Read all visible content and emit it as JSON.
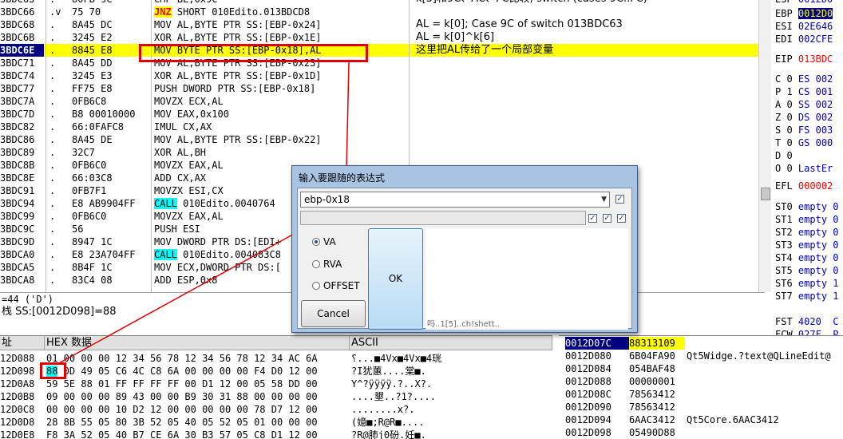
{
  "disasm": {
    "rows": [
      {
        "addr": "3BDC63",
        "mark": ".",
        "hex": "80FB 9C",
        "asm": "CMP BL,0x9C",
        "comment": "k[3]和9C、AC、FC比较; switch (cases 9C..FC)"
      },
      {
        "addr": "3BDC66",
        "mark": ".v",
        "hex": "75 70",
        "asm_jmp": "JNZ",
        "asm": " SHORT 010Edito.013BDCD8",
        "comment": ""
      },
      {
        "addr": "3BDC68",
        "mark": ".",
        "hex": "8A45 DC",
        "asm": "MOV AL,BYTE PTR SS:[EBP-0x24]",
        "comment": "AL = k[0]; Case 9C of switch 013BDC63"
      },
      {
        "addr": "3BDC6B",
        "mark": ".",
        "hex": "3245 E2",
        "asm": "XOR AL,BYTE PTR SS:[EBP-0x1E]",
        "comment": "AL = k[0]^k[6]"
      },
      {
        "addr": "3BDC6E",
        "mark": ".",
        "hex": "8845 E8",
        "asm": "MOV BYTE PTR SS:[EBP-0x18],AL",
        "comment": "这里把AL传给了一个局部变量"
      },
      {
        "addr": "3BDC71",
        "mark": ".",
        "hex": "8A45 DD",
        "asm": "MOV AL,BYTE PTR SS:[EBP-0x23]",
        "comment": ""
      },
      {
        "addr": "3BDC74",
        "mark": ".",
        "hex": "3245 E3",
        "asm": "XOR AL,BYTE PTR SS:[EBP-0x1D]",
        "comment": ""
      },
      {
        "addr": "3BDC77",
        "mark": ".",
        "hex": "FF75 E8",
        "asm": "PUSH DWORD PTR SS:[EBP-0x18]",
        "comment": ""
      },
      {
        "addr": "3BDC7A",
        "mark": ".",
        "hex": "0FB6C8",
        "asm": "MOVZX ECX,AL",
        "comment": ""
      },
      {
        "addr": "3BDC7D",
        "mark": ".",
        "hex": "B8 00010000",
        "asm": "MOV EAX,0x100",
        "comment": ""
      },
      {
        "addr": "3BDC82",
        "mark": ".",
        "hex": "66:0FAFC8",
        "asm": "IMUL CX,AX",
        "comment": ""
      },
      {
        "addr": "3BDC86",
        "mark": ".",
        "hex": "8A45 DE",
        "asm": "MOV AL,BYTE PTR SS:[EBP-0x22]",
        "comment": ""
      },
      {
        "addr": "3BDC89",
        "mark": ".",
        "hex": "32C7",
        "asm": "XOR AL,BH",
        "comment": ""
      },
      {
        "addr": "3BDC8B",
        "mark": ".",
        "hex": "0FB6C0",
        "asm": "MOVZX EAX,AL",
        "comment": ""
      },
      {
        "addr": "3BDC8E",
        "mark": ".",
        "hex": "66:03C8",
        "asm": "ADD CX,AX",
        "comment": ""
      },
      {
        "addr": "3BDC91",
        "mark": ".",
        "hex": "0FB7F1",
        "asm": "MOVZX ESI,CX",
        "comment": ""
      },
      {
        "addr": "3BDC94",
        "mark": ".",
        "hex": "E8 AB9904FF",
        "asm_call": "CALL",
        "asm": " 010Edito.0040764",
        "comment": ""
      },
      {
        "addr": "3BDC99",
        "mark": ".",
        "hex": "0FB6C0",
        "asm": "MOVZX EAX,AL",
        "comment": ""
      },
      {
        "addr": "3BDC9C",
        "mark": ".",
        "hex": "56",
        "asm": "PUSH ESI",
        "comment": ""
      },
      {
        "addr": "3BDC9D",
        "mark": ".",
        "hex": "8947 1C",
        "asm": "MOV DWORD PTR DS:[EDI+",
        "comment": ""
      },
      {
        "addr": "3BDCA0",
        "mark": ".",
        "hex": "E8 23A704FF",
        "asm_call": "CALL",
        "asm": " 010Edito.004083C8",
        "comment": ""
      },
      {
        "addr": "3BDCA5",
        "mark": ".",
        "hex": "8B4F 1C",
        "asm": "MOV ECX,DWORD PTR DS:[",
        "comment": ""
      },
      {
        "addr": "3BDCA8",
        "mark": ".",
        "hex": "83C4 08",
        "asm": "ADD ESP,0x8",
        "comment": ""
      }
    ]
  },
  "registers": [
    {
      "name": "ESP",
      "val": "0012D0"
    },
    {
      "name": "EBP",
      "val": "0012D0",
      "sel": true
    },
    {
      "name": "ESI",
      "val": "02E646"
    },
    {
      "name": "EDI",
      "val": "002CFE"
    },
    {
      "name": "",
      "val": ""
    },
    {
      "name": "EIP",
      "val": "013BDC",
      "red": true
    },
    {
      "name": "",
      "val": ""
    },
    {
      "name": "C 0",
      "val": "ES 002"
    },
    {
      "name": "P 1",
      "val": "CS 001"
    },
    {
      "name": "A 0",
      "val": "SS 002"
    },
    {
      "name": "Z 0",
      "val": "DS 002",
      "redname": true
    },
    {
      "name": "S 0",
      "val": "FS 003"
    },
    {
      "name": "T 0",
      "val": "GS 000"
    },
    {
      "name": "D 0",
      "val": ""
    },
    {
      "name": "O 0",
      "val": "LastEr"
    },
    {
      "name": "",
      "val": ""
    },
    {
      "name": "EFL",
      "val": "000002",
      "red": true
    },
    {
      "name": "",
      "val": ""
    },
    {
      "name": "ST0",
      "val": "empty 0"
    },
    {
      "name": "ST1",
      "val": "empty 0"
    },
    {
      "name": "ST2",
      "val": "empty 0"
    },
    {
      "name": "ST3",
      "val": "empty 0"
    },
    {
      "name": "ST4",
      "val": "empty 0"
    },
    {
      "name": "ST5",
      "val": "empty 0"
    },
    {
      "name": "ST6",
      "val": "empty 1"
    },
    {
      "name": "ST7",
      "val": "empty 1"
    },
    {
      "name": "",
      "val": ""
    },
    {
      "name": "FST",
      "val": "4020  C"
    },
    {
      "name": "FCW",
      "val": "027F  P"
    }
  ],
  "info": {
    "line1": "=44 ('D')",
    "line2": "栈 SS:[0012D098]=88"
  },
  "dump": {
    "col_addr": "址",
    "col_hex": "HEX 数据",
    "col_ascii": "ASCII",
    "rows": [
      {
        "addr": "12D088",
        "hex_pre": "",
        "hex_sel": "",
        "hex": "01 00 00 00 12 34 56 78 12 34 56 78 12 34 AC 6A",
        "ascii": "⸮...■4Vx■4Vx■4珖"
      },
      {
        "addr": "12D098",
        "hex_pre": "",
        "hex_sel": "88",
        "hex": " 0D 49 05 C6 4C C8 6A 00 00 00 00 F4 D0 12 00",
        "ascii": "?I犹蕙....棠■."
      },
      {
        "addr": "12D0A8",
        "hex_pre": "",
        "hex_sel": "",
        "hex": "59 5E 88 01 FF FF FF FF 00 D1 12 00 05 58 DD 00",
        "ascii": "Y^?ÿÿÿÿ.?..X?."
      },
      {
        "addr": "12D0B8",
        "hex_pre": "",
        "hex_sel": "",
        "hex": "09 00 00 00 89 43 00 00 B9 30 31 88 00 00 00 00",
        "ascii": "....墾..?1?...."
      },
      {
        "addr": "12D0C8",
        "hex_pre": "",
        "hex_sel": "",
        "hex": "00 00 00 00 10 D2 12 00 00 00 00 00 78 D7 12 00",
        "ascii": "........x?."
      },
      {
        "addr": "12D0D8",
        "hex_pre": "",
        "hex_sel": "",
        "hex": "28 8B 55 05 80 3B 52 05 40 05 52 05 01 00 00 00",
        "ascii": "(嬑■;R@R■...."
      },
      {
        "addr": "12D0E8",
        "hex_pre": "",
        "hex_sel": "",
        "hex": "F8 3A 52 05 40 B7 CE 6A 30 B3 57 05 C8 D1 12 00",
        "ascii": "?R@肺j0砏.妊■."
      }
    ]
  },
  "stack": {
    "rows": [
      {
        "addr": "0012D07C",
        "val": "88313109",
        "comment": ""
      },
      {
        "addr": "0012D080",
        "val": "6B04FA90",
        "comment": "Qt5Widge.?text@QLineEdit@"
      },
      {
        "addr": "0012D084",
        "val": "054BAF48",
        "comment": ""
      },
      {
        "addr": "0012D088",
        "val": "00000001",
        "comment": ""
      },
      {
        "addr": "0012D08C",
        "val": "78563412",
        "comment": ""
      },
      {
        "addr": "0012D090",
        "val": "78563412",
        "comment": ""
      },
      {
        "addr": "0012D094",
        "val": "6AAC3412",
        "comment": "Qt5Core.6AAC3412"
      },
      {
        "addr": "0012D098",
        "val": "05490D88",
        "comment": ""
      }
    ]
  },
  "dialog": {
    "title": "输入要跟随的表达式",
    "expression": "ebp-0x18",
    "radio_va": "VA",
    "radio_rva": "RVA",
    "radio_offset": "OFFSET",
    "ok": "OK",
    "cancel": "Cancel",
    "footnote": "吗..1[5]..ch!shett.."
  },
  "colors": {
    "selection": "#ffff00",
    "annotation_red": "#e00000",
    "dialog_frame": "#a9c3e3"
  }
}
